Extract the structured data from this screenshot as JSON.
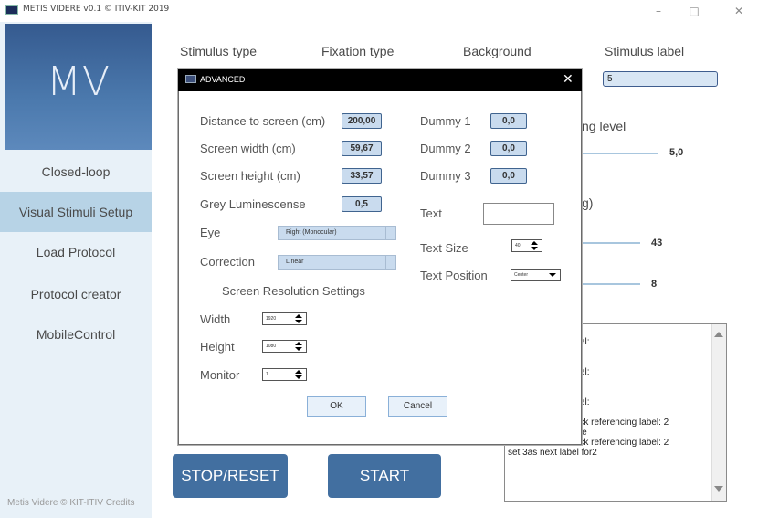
{
  "window": {
    "title": "METIS VIDERE v0.1 © ITIV-KIT 2019",
    "minimize": "–",
    "maximize": "□",
    "close": "✕"
  },
  "sidebar": {
    "logo": "MV",
    "items": [
      {
        "label": "Closed-loop",
        "active": false
      },
      {
        "label": "Visual Stimuli Setup",
        "active": true
      },
      {
        "label": "Load Protocol",
        "active": false
      },
      {
        "label": "Protocol creator",
        "active": false
      },
      {
        "label": "MobileControl",
        "active": false
      }
    ],
    "footer": "Metis Videre © KIT-ITIV Credits"
  },
  "main": {
    "headers": {
      "stimulus_type": "Stimulus type",
      "fixation_type": "Fixation type",
      "background": "Background",
      "stimulus_label": "Stimulus label"
    },
    "stimulus_label_value": "5",
    "partial_level_label": "ng level",
    "slider1_value": "5,0",
    "partial_deg_label": "g)",
    "slider2_value": "43",
    "slider3_value": "8",
    "log_lines": [
      "ate",
      "ck referencing label:",
      "",
      "ate",
      "ck referencing label:",
      "",
      "ate",
      "ck referencing label:",
      "",
      "Received Feedback referencing label: 2",
      "Entering IDLE state",
      "Received Feedback referencing label: 2",
      "set 3as next label for2"
    ],
    "stop_reset": "STOP/RESET",
    "start": "START"
  },
  "dialog": {
    "title": "ADVANCED",
    "close": "✕",
    "distance_label": "Distance to screen (cm)",
    "distance_value": "200,00",
    "screen_width_label": "Screen width (cm)",
    "screen_width_value": "59,67",
    "screen_height_label": "Screen height (cm)",
    "screen_height_value": "33,57",
    "grey_label": "Grey Luminescense",
    "grey_value": "0,5",
    "eye_label": "Eye",
    "eye_value": "Right (Monocular)",
    "correction_label": "Correction",
    "correction_value": "Linear",
    "resolution_heading": "Screen Resolution Settings",
    "width_label": "Width",
    "width_value": "1920",
    "height_label": "Height",
    "height_value": "1080",
    "monitor_label": "Monitor",
    "monitor_value": "1",
    "dummy1_label": "Dummy 1",
    "dummy1_value": "0,0",
    "dummy2_label": "Dummy 2",
    "dummy2_value": "0,0",
    "dummy3_label": "Dummy 3",
    "dummy3_value": "0,0",
    "text_label": "Text",
    "text_value": "",
    "text_size_label": "Text Size",
    "text_size_value": "40",
    "text_position_label": "Text Position",
    "text_position_value": "Center",
    "ok": "OK",
    "cancel": "Cancel"
  }
}
